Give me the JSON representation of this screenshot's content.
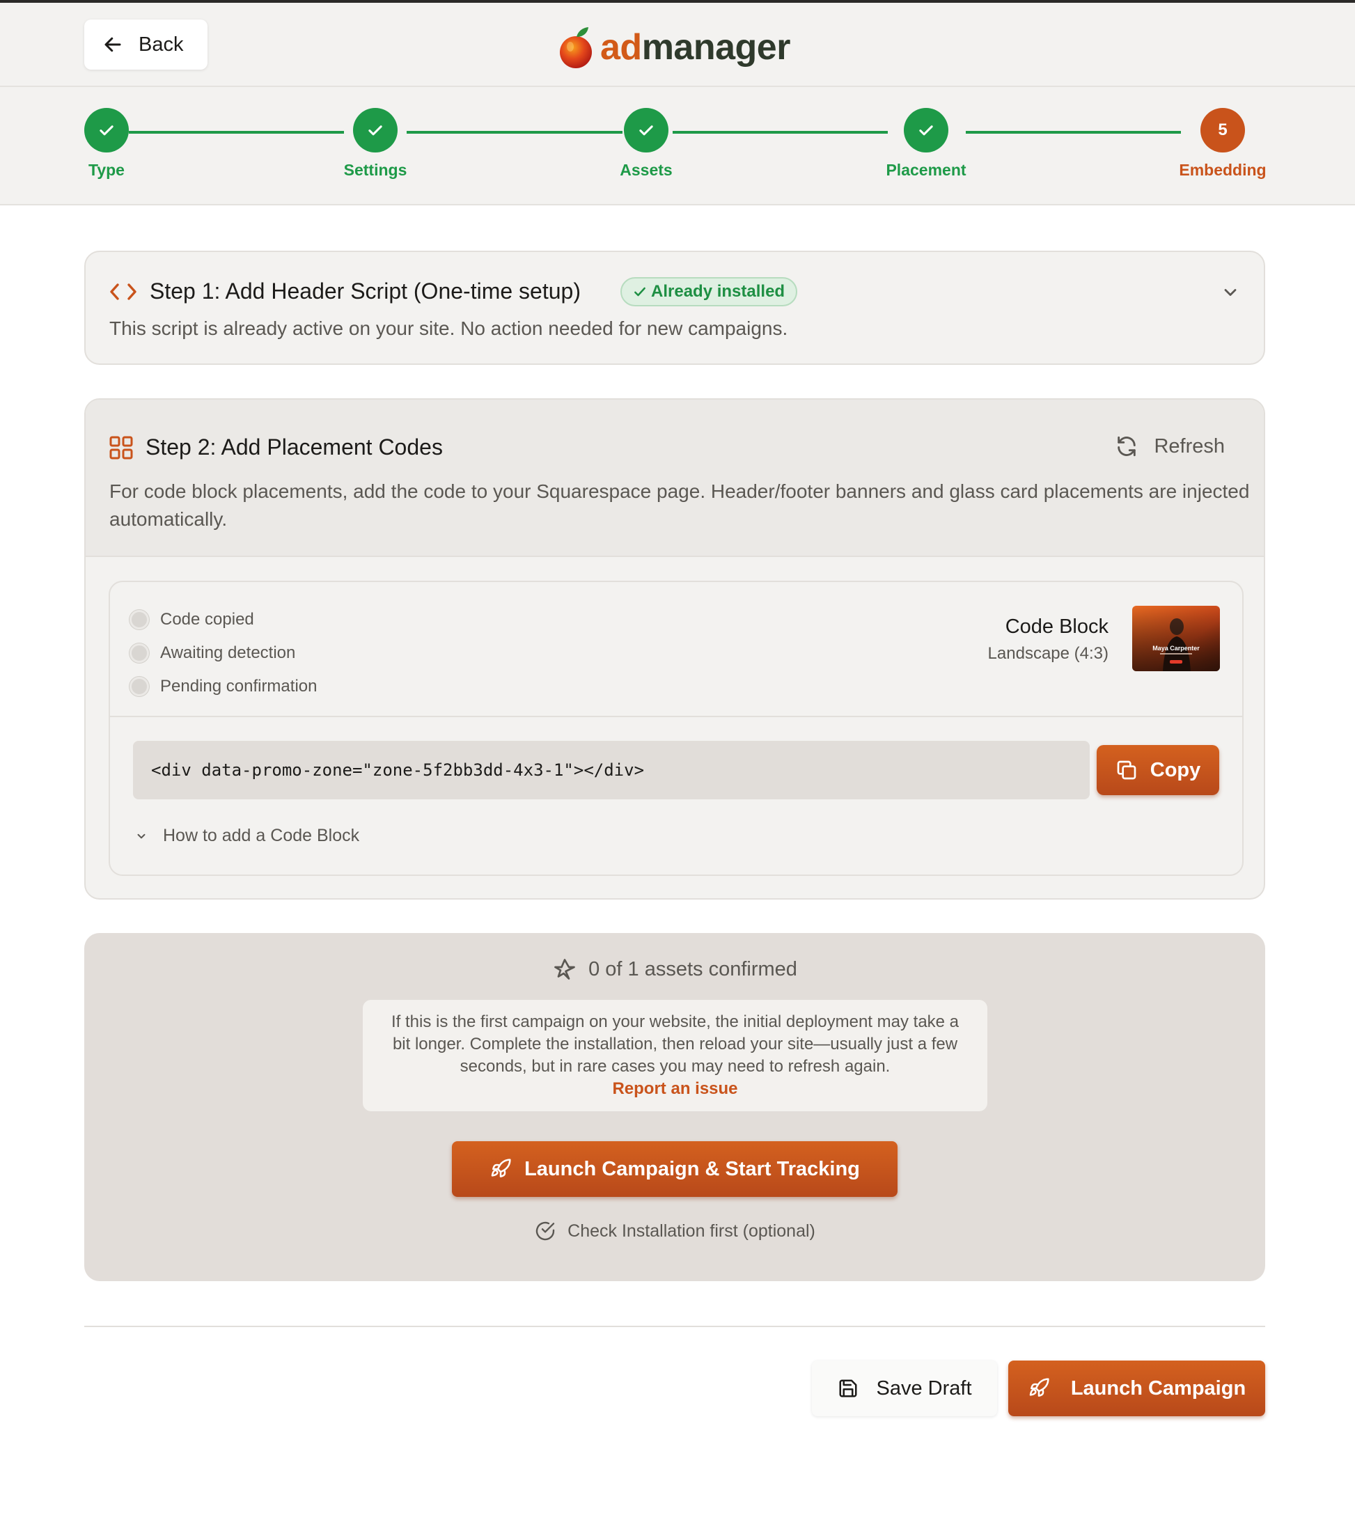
{
  "header": {
    "back_label": "Back",
    "logo_part1": "ad",
    "logo_part2": "manager"
  },
  "stepper": {
    "steps": [
      {
        "label": "Type",
        "state": "done"
      },
      {
        "label": "Settings",
        "state": "done"
      },
      {
        "label": "Assets",
        "state": "done"
      },
      {
        "label": "Placement",
        "state": "done"
      },
      {
        "label": "Embedding",
        "state": "current",
        "number": "5"
      }
    ]
  },
  "step1": {
    "title": "Step 1: Add Header Script (One-time setup)",
    "badge": "Already installed",
    "description": "This script is already active on your site. No action needed for new campaigns."
  },
  "step2": {
    "title": "Step 2: Add Placement Codes",
    "refresh_label": "Refresh",
    "description": "For code block placements, add the code to your Squarespace page. Header/footer banners and glass card placements are injected automatically.",
    "statuses": [
      "Code copied",
      "Awaiting detection",
      "Pending confirmation"
    ],
    "placement_type": "Code Block",
    "placement_format": "Landscape (4:3)",
    "thumbnail_caption": "Maya Carpenter",
    "code": "<div data-promo-zone=\"zone-5f2bb3dd-4x3-1\"></div>",
    "copy_label": "Copy",
    "howto_label": "How to add a Code Block"
  },
  "confirmation": {
    "status": "0 of 1 assets confirmed",
    "note": "If this is the first campaign on your website, the initial deployment may take a bit longer. Complete the installation, then reload your site—usually just a few seconds, but in rare cases you may need to refresh again.",
    "report_link": "Report an issue",
    "launch_label": "Launch Campaign & Start Tracking",
    "check_label": "Check Installation first (optional)"
  },
  "footer": {
    "save_label": "Save Draft",
    "launch_label": "Launch Campaign"
  },
  "colors": {
    "accent": "#c9531b",
    "success": "#1e9a48",
    "page_bg": "#f3f2f0"
  }
}
